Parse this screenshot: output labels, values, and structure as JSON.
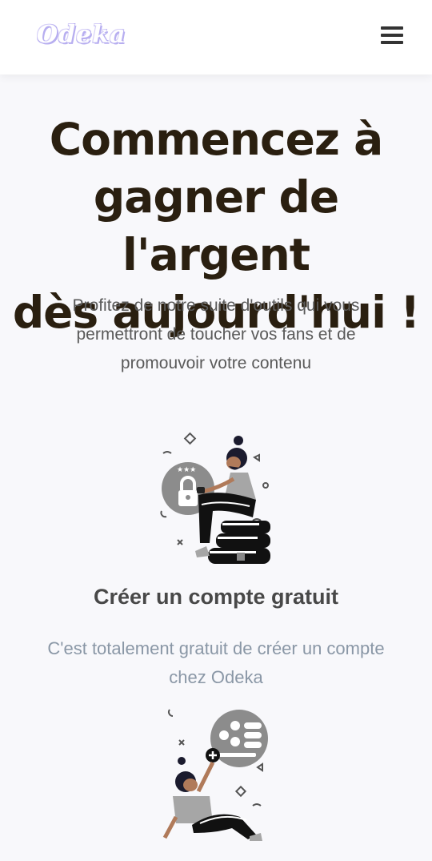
{
  "header": {
    "logo_text": "Odeka",
    "menu_icon": "hamburger-menu-icon"
  },
  "hero": {
    "title_lines": [
      "Commencez à",
      "gagner de l'argent",
      "dès aujourd'hui !"
    ],
    "subtitle_lines": [
      "Profitez de notre suite d'outils qui vous",
      "permettront de toucher vos fans et de",
      "promouvoir votre contenu"
    ]
  },
  "feature": {
    "title": "Créer un compte gratuit",
    "desc_lines": [
      "C'est totalement gratuit de créer un compte",
      "chez Odeka"
    ]
  },
  "colors": {
    "background": "#f8f8fb",
    "title": "#2a1f10",
    "subtitle": "#5a5a5a",
    "feature_title": "#484848",
    "feature_desc": "#8a97a6",
    "logo": "#b7aef0"
  }
}
